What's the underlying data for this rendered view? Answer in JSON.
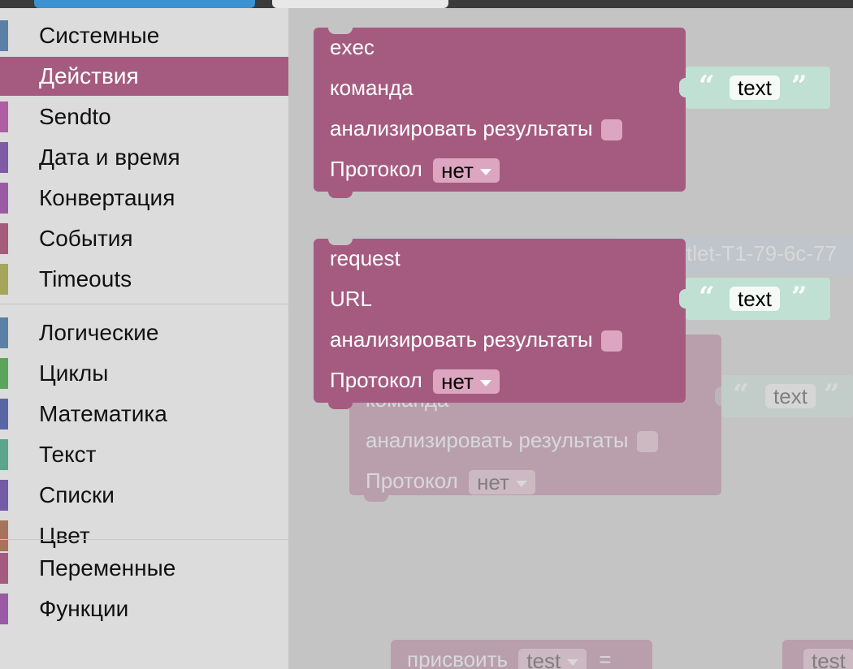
{
  "toolbox": {
    "selected": "Действия",
    "groups": [
      [
        {
          "label": "Системные",
          "color": "#5b80a5"
        },
        {
          "label": "Действия",
          "color": "#a55b80"
        },
        {
          "label": "Sendto",
          "color": "#b05ea4"
        },
        {
          "label": "Дата и время",
          "color": "#7f5ba5"
        },
        {
          "label": "Конвертация",
          "color": "#9a5ba5"
        },
        {
          "label": "События",
          "color": "#a55b7a"
        },
        {
          "label": "Timeouts",
          "color": "#a5a55b"
        }
      ],
      [
        {
          "label": "Логические",
          "color": "#5b80a5"
        },
        {
          "label": "Циклы",
          "color": "#5ba55b"
        },
        {
          "label": "Математика",
          "color": "#5b67a5"
        },
        {
          "label": "Текст",
          "color": "#5ba58c"
        },
        {
          "label": "Списки",
          "color": "#745ba5"
        },
        {
          "label": "Цвет",
          "color": "#a5745b"
        }
      ],
      [
        {
          "label": "Переменные",
          "color": "#a55b80"
        },
        {
          "label": "Функции",
          "color": "#995ba5"
        }
      ]
    ]
  },
  "blocks": {
    "exec": {
      "title": "exec",
      "command_label": "команда",
      "analyze_label": "анализировать результаты",
      "protocol_label": "Протокол",
      "protocol_value": "нет",
      "text_value": "text"
    },
    "request": {
      "title": "request",
      "url_label": "URL",
      "analyze_label": "анализировать результаты",
      "protocol_label": "Протокол",
      "protocol_value": "нет",
      "text_value": "text"
    },
    "ghost_exec": {
      "title_fragment": "команда",
      "analyze_label": "анализировать результаты",
      "protocol_label": "Протокол",
      "protocol_value": "нет",
      "text_value": "text"
    },
    "ghost_id_fragment": "tlet-T1-79-6c-77",
    "assign": {
      "label": "присвоить",
      "var": "test",
      "eq": "=",
      "right_var": "test"
    }
  },
  "quote_open": "“",
  "quote_close": "”"
}
